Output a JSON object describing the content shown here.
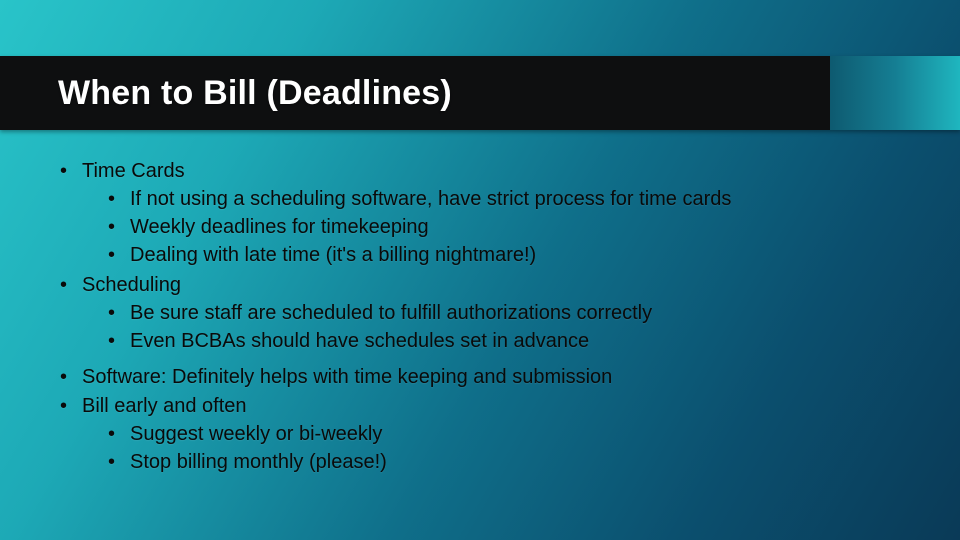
{
  "title": "When to Bill (Deadlines)",
  "bullets": [
    {
      "text": "Time Cards",
      "sub": [
        "If not using a scheduling software, have strict process for time cards",
        "Weekly deadlines for timekeeping",
        "Dealing with late time (it's a billing nightmare!)"
      ]
    },
    {
      "text": "Scheduling",
      "sub": [
        "Be sure staff are scheduled to fulfill authorizations correctly",
        "Even BCBAs should have schedules set in advance"
      ]
    },
    {
      "text": "Software: Definitely helps with time keeping and submission",
      "sub": []
    },
    {
      "text": "Bill early and often",
      "sub": [
        "Suggest weekly or bi-weekly",
        "Stop billing monthly (please!)"
      ]
    }
  ]
}
